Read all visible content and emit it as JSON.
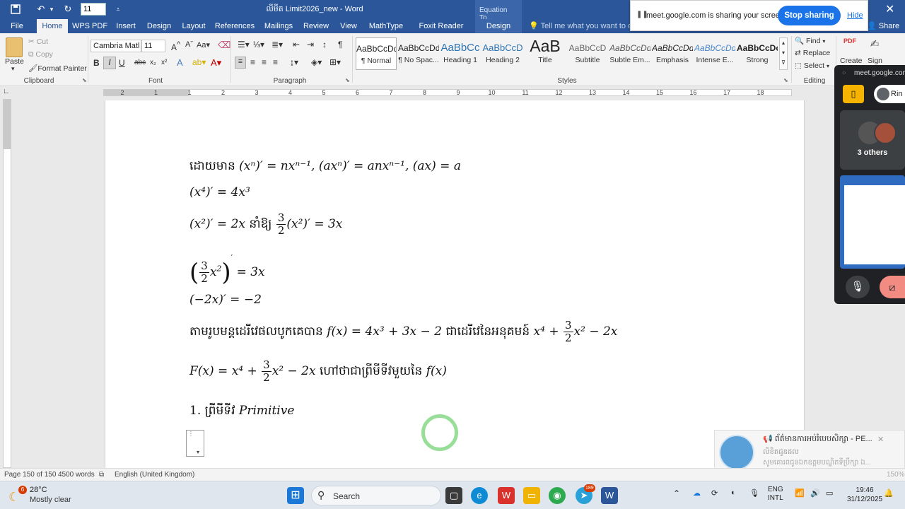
{
  "titlebar": {
    "font_size_value": "11",
    "doc_title": "លីមីត Limit2026_new  -  Word",
    "equation_tools": "Equation To..."
  },
  "tabs": [
    {
      "label": "File"
    },
    {
      "label": "Home"
    },
    {
      "label": "WPS PDF"
    },
    {
      "label": "Insert"
    },
    {
      "label": "Design"
    },
    {
      "label": "Layout"
    },
    {
      "label": "References"
    },
    {
      "label": "Mailings"
    },
    {
      "label": "Review"
    },
    {
      "label": "View"
    },
    {
      "label": "MathType"
    },
    {
      "label": "Foxit Reader PDF"
    },
    {
      "label": "Design"
    }
  ],
  "tell_me": "Tell me what you want to do",
  "share": "Share",
  "meet_banner": {
    "message": "meet.google.com is sharing your screen.",
    "stop_label": "Stop sharing",
    "hide_label": "Hide"
  },
  "ribbon": {
    "clipboard": {
      "paste": "Paste",
      "cut": "Cut",
      "copy": "Copy",
      "format_painter": "Format Painter",
      "label": "Clipboard"
    },
    "font": {
      "font_name": "Cambria Matl",
      "font_size": "11",
      "label": "Font"
    },
    "paragraph": {
      "label": "Paragraph"
    },
    "styles": {
      "label": "Styles",
      "items": [
        {
          "sample": "AaBbCcDd",
          "name": "¶ Normal"
        },
        {
          "sample": "AaBbCcDd",
          "name": "¶ No Spac..."
        },
        {
          "sample": "AaBbCc",
          "name": "Heading 1"
        },
        {
          "sample": "AaBbCcD",
          "name": "Heading 2"
        },
        {
          "sample": "AaB",
          "name": "Title"
        },
        {
          "sample": "AaBbCcD",
          "name": "Subtitle"
        },
        {
          "sample": "AaBbCcDd",
          "name": "Subtle Em..."
        },
        {
          "sample": "AaBbCcDd",
          "name": "Emphasis"
        },
        {
          "sample": "AaBbCcDd",
          "name": "Intense E..."
        },
        {
          "sample": "AaBbCcDc",
          "name": "Strong"
        }
      ]
    },
    "editing": {
      "find": "Find",
      "replace": "Replace",
      "select": "Select",
      "label": "Editing"
    },
    "foxit": {
      "create": "Create",
      "sign": "Sign"
    }
  },
  "ruler": {
    "numbers": [
      "2",
      "1",
      "1",
      "2",
      "3",
      "4",
      "5",
      "6",
      "7",
      "8",
      "9",
      "10",
      "11",
      "12",
      "13",
      "14",
      "15",
      "16",
      "17",
      "18"
    ]
  },
  "document": {
    "l1_prefix": "ដោយមាន",
    "l1_math": "(xⁿ)′ = nxⁿ⁻¹, (axⁿ)′ = anxⁿ⁻¹, (ax) = a",
    "l2_math": "(x⁴)′ = 4x³",
    "l3_math_a": "(x²)′ = 2x",
    "l3_khmer": "នាំឱ្យ",
    "l3_frac_num": "3",
    "l3_frac_den": "2",
    "l3_math_b": "(x²)′ = 3x",
    "l4_frac_num": "3",
    "l4_frac_den": "2",
    "l4_math": "= 3x",
    "l5_math": "(−2x)′ = −2",
    "l6_khmer_a": "តាមរូបមន្តដេរីវេផលបូកគេបាន",
    "l6_math_a": "f(x) =  4x³ + 3x − 2",
    "l6_khmer_b": "ជាដេរីវេនៃអនុគមន៍",
    "l6_math_b1": "x⁴ +",
    "l6_frac_num": "3",
    "l6_frac_den": "2",
    "l6_math_b2": "x² − 2x",
    "l7_math_a": "F(x) = x⁴ +",
    "l7_frac_num": "3",
    "l7_frac_den": "2",
    "l7_math_b": "x² − 2x",
    "l7_khmer": "ហៅថាជាព្រីមីទីវមួយនៃ",
    "l7_math_c": "f(x)",
    "l8_number": "1.",
    "l8_khmer": "ព្រីមីទីវ",
    "l8_math": "Primitive"
  },
  "meet_panel": {
    "header": "meet.google.com",
    "rin": "Rin",
    "others": "3 others"
  },
  "notification": {
    "title": "📢 ព័ត៌មានការអប់រំបេបសិក្សា - PE...",
    "line2": "លិខិតជូនដល",
    "line3": "សូមគោរពជូនឯកឧត្តមបណ្ឌិតទីប្រឹក្សា ឯ..."
  },
  "statusbar": {
    "page": "Page 150 of 150",
    "words": "4500 words",
    "language": "English (United Kingdom)",
    "zoom": "150%"
  },
  "taskbar": {
    "weather_temp": "28°C",
    "weather_desc": "Mostly clear",
    "weather_badge": "6",
    "search": "Search",
    "lang1": "ENG",
    "lang2": "INTL",
    "time": "19:46",
    "date": "31/12/2025",
    "telegram_badge": "189"
  }
}
